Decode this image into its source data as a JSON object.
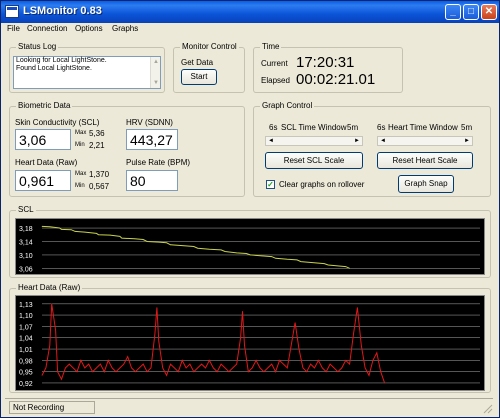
{
  "window": {
    "title": "LSMonitor 0.83"
  },
  "menu": [
    "File",
    "Connection",
    "Options",
    "Graphs"
  ],
  "status_log": {
    "title": "Status Log",
    "lines": [
      "Looking for Local LightStone.",
      "Found Local LightStone."
    ]
  },
  "monitor_control": {
    "title": "Monitor Control",
    "label": "Get Data",
    "start_label": "Start"
  },
  "time": {
    "title": "Time",
    "current_label": "Current",
    "current_value": "17:20:31",
    "elapsed_label": "Elapsed",
    "elapsed_value": "00:02:21.01"
  },
  "biometric": {
    "title": "Biometric Data",
    "scl_label": "Skin Conductivity (SCL)",
    "scl_value": "3,06",
    "scl_max_label": "Max",
    "scl_max": "5,36",
    "scl_min_label": "Min",
    "scl_min": "2,21",
    "hrv_label": "HRV (SDNN)",
    "hrv_value": "443,27",
    "hr_label": "Heart Data (Raw)",
    "hr_value": "0,961",
    "hr_max_label": "Max",
    "hr_max": "1,370",
    "hr_min_label": "Min",
    "hr_min": "0,567",
    "pulse_label": "Pulse Rate (BPM)",
    "pulse_value": "80"
  },
  "graph_control": {
    "title": "Graph Control",
    "scl_window_min": "6s",
    "scl_window_label": "SCL Time Window",
    "scl_window_max": "5m",
    "heart_window_min": "6s",
    "heart_window_label": "Heart Time Window",
    "heart_window_max": "5m",
    "reset_scl": "Reset SCL Scale",
    "reset_heart": "Reset Heart Scale",
    "clear_on_rollover": "Clear graphs on rollover",
    "clear_checked": true,
    "graph_snap": "Graph Snap"
  },
  "scl_graph": {
    "title": "SCL"
  },
  "heart_graph": {
    "title": "Heart Data (Raw)"
  },
  "status": {
    "text": "Not Recording"
  },
  "colors": {
    "scl_line": "#c8d24a",
    "heart_line": "#e01818",
    "grid": "#8a8a8a",
    "graph_bg": "#000000",
    "titlebar": "#0a54d8"
  },
  "chart_data": [
    {
      "type": "line",
      "title": "SCL",
      "yticks": [
        "3,18",
        "3,14",
        "3,10",
        "3,06"
      ],
      "ylim": [
        3.055,
        3.195
      ],
      "grid": true,
      "series": [
        {
          "x": [
            0,
            8,
            18,
            20,
            30,
            34,
            44,
            56,
            58,
            70,
            80,
            82,
            95,
            104,
            108,
            120,
            128,
            132,
            146,
            156,
            160,
            172,
            184,
            188,
            200,
            210,
            214,
            226,
            236,
            240,
            252,
            262,
            266,
            278,
            290,
            294,
            305,
            312,
            316
          ],
          "y": [
            3.185,
            3.184,
            3.18,
            3.176,
            3.175,
            3.17,
            3.168,
            3.164,
            3.16,
            3.159,
            3.155,
            3.15,
            3.148,
            3.146,
            3.14,
            3.138,
            3.136,
            3.13,
            3.127,
            3.125,
            3.12,
            3.117,
            3.115,
            3.11,
            3.106,
            3.104,
            3.1,
            3.097,
            3.095,
            3.09,
            3.087,
            3.085,
            3.08,
            3.077,
            3.074,
            3.07,
            3.067,
            3.065,
            3.06
          ]
        }
      ]
    },
    {
      "type": "line",
      "title": "Heart Data (Raw)",
      "yticks": [
        "1,13",
        "1,10",
        "1,07",
        "1,04",
        "1,01",
        "0,98",
        "0,95",
        "0,92"
      ],
      "ylim": [
        0.912,
        1.14
      ],
      "grid": true,
      "series": [
        {
          "x": [
            0,
            4,
            8,
            10,
            14,
            16,
            20,
            24,
            28,
            32,
            36,
            40,
            44,
            48,
            52,
            56,
            60,
            64,
            68,
            72,
            76,
            80,
            84,
            88,
            92,
            96,
            100,
            104,
            108,
            112,
            116,
            118,
            120,
            124,
            128,
            132,
            136,
            140,
            144,
            148,
            152,
            156,
            160,
            164,
            168,
            172,
            176,
            180,
            184,
            188,
            192,
            196,
            200,
            204,
            206,
            208,
            212,
            216,
            220,
            224,
            228,
            232,
            236,
            240,
            244,
            248,
            252,
            256,
            260,
            264,
            268,
            272,
            276,
            280,
            284,
            288,
            292,
            296,
            300,
            304,
            308,
            312,
            316,
            320,
            324,
            328,
            332,
            336,
            340,
            344,
            348,
            352
          ],
          "y": [
            0.94,
            0.96,
            1.02,
            1.13,
            1.06,
            0.95,
            0.93,
            0.96,
            0.97,
            0.96,
            0.95,
            0.98,
            0.96,
            0.97,
            0.95,
            0.96,
            0.97,
            0.95,
            0.98,
            0.96,
            0.95,
            0.96,
            0.97,
            0.99,
            0.96,
            0.95,
            0.96,
            0.97,
            0.95,
            0.96,
            1.05,
            1.12,
            1.03,
            0.96,
            0.94,
            0.97,
            0.96,
            0.95,
            0.98,
            0.96,
            0.97,
            0.95,
            0.96,
            0.97,
            0.96,
            0.98,
            0.96,
            0.95,
            0.97,
            0.96,
            0.95,
            0.96,
            0.97,
            1.04,
            1.11,
            1.02,
            0.95,
            0.96,
            0.98,
            0.96,
            0.95,
            0.96,
            0.97,
            0.95,
            0.98,
            0.97,
            0.96,
            1.02,
            1.08,
            1.01,
            0.96,
            0.95,
            0.97,
            0.96,
            0.98,
            0.96,
            0.95,
            0.97,
            0.96,
            0.95,
            0.96,
            0.98,
            0.97,
            1.05,
            1.12,
            1.02,
            0.96,
            0.94,
            0.98,
            1.0,
            0.95,
            0.92
          ]
        }
      ]
    }
  ]
}
